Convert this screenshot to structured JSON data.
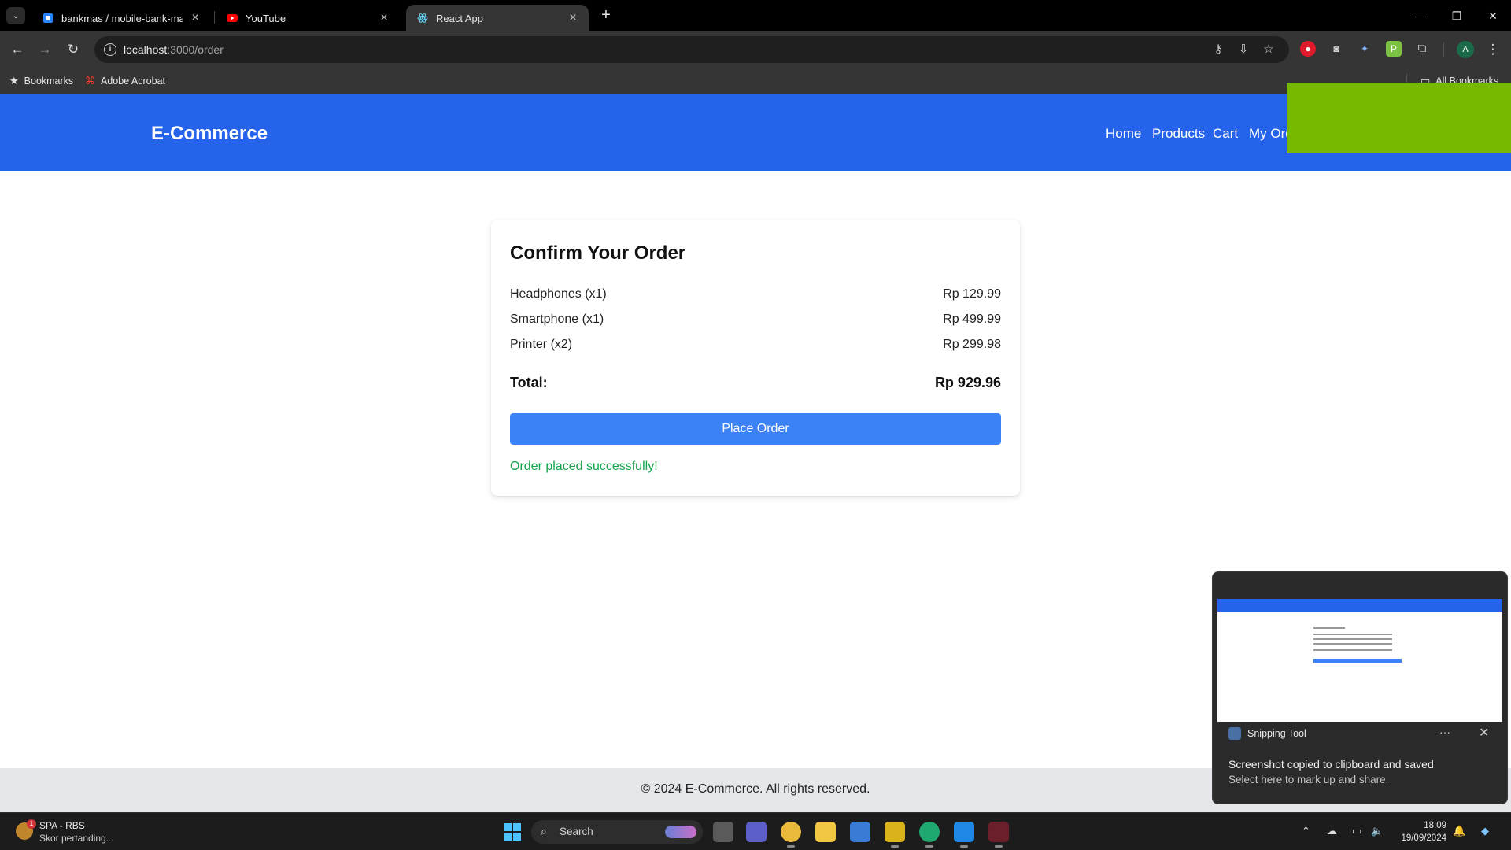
{
  "browser": {
    "tabs": [
      {
        "title": "bankmas / mobile-bank-mas —",
        "active": false
      },
      {
        "title": "YouTube",
        "active": false
      },
      {
        "title": "React App",
        "active": true
      }
    ],
    "url": {
      "host": "localhost",
      "path": ":3000/order"
    },
    "bookmarks": {
      "items": [
        {
          "label": "Bookmarks",
          "icon": "star-icon"
        },
        {
          "label": "Adobe Acrobat",
          "icon": "acrobat-icon"
        }
      ],
      "all_label": "All Bookmarks"
    },
    "profile_initial": "A"
  },
  "app": {
    "brand": "E-Commerce",
    "nav": [
      "Home",
      "Products",
      "Cart",
      "My Orders"
    ]
  },
  "order": {
    "title": "Confirm Your Order",
    "items": [
      {
        "name": "Headphones (x1)",
        "price": "Rp 129.99"
      },
      {
        "name": "Smartphone (x1)",
        "price": "Rp 499.99"
      },
      {
        "name": "Printer (x2)",
        "price": "Rp 299.98"
      }
    ],
    "total_label": "Total:",
    "total_value": "Rp 929.96",
    "button_label": "Place Order",
    "success_message": "Order placed successfully!"
  },
  "footer": {
    "text": "© 2024 E-Commerce. All rights reserved."
  },
  "toast": {
    "app_name": "Snipping Tool",
    "more": "···",
    "headline": "Screenshot copied to clipboard and saved",
    "body": "Select here to mark up and share."
  },
  "taskbar": {
    "widget_title": "SPA - RBS",
    "widget_subtitle": "Skor pertanding...",
    "widget_badge": "1",
    "search_label": "Search",
    "time": "18:09",
    "date": "19/09/2024"
  },
  "colors": {
    "header": "#2563eb",
    "button": "#3b82f6",
    "success": "#16a34a",
    "overlay_green": "#77b900"
  }
}
